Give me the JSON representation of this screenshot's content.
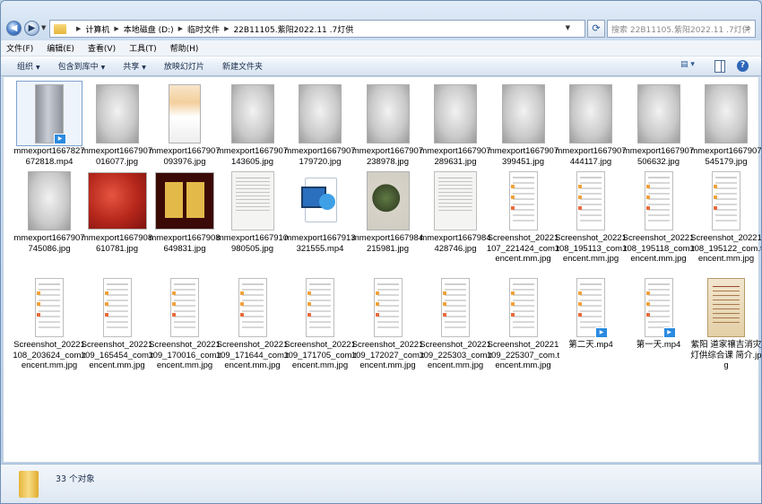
{
  "address": {
    "crumbs": [
      "计算机",
      "本地磁盘 (D:)",
      "临时文件",
      "22B11105.紫阳2022.11 .7灯供"
    ],
    "search_placeholder": "搜索 22B11105.紫阳2022.11 .7灯供"
  },
  "menu": [
    "文件(F)",
    "编辑(E)",
    "查看(V)",
    "工具(T)",
    "帮助(H)"
  ],
  "toolbar": {
    "organize": "组织",
    "include_library": "包含到库中",
    "share": "共享",
    "slideshow": "放映幻灯片",
    "new_folder": "新建文件夹"
  },
  "files": [
    {
      "name": "mmexport1667827672818.mp4",
      "kind": "vid",
      "video": true,
      "selected": true
    },
    {
      "name": "mmexport1667907016077.jpg",
      "kind": "gray"
    },
    {
      "name": "mmexport1667907093976.jpg",
      "kind": "promo"
    },
    {
      "name": "mmexport1667907143605.jpg",
      "kind": "gray"
    },
    {
      "name": "mmexport1667907179720.jpg",
      "kind": "gray"
    },
    {
      "name": "mmexport1667907238978.jpg",
      "kind": "gray"
    },
    {
      "name": "mmexport1667907289631.jpg",
      "kind": "gray"
    },
    {
      "name": "mmexport1667907399451.jpg",
      "kind": "gray"
    },
    {
      "name": "mmexport1667907444117.jpg",
      "kind": "gray"
    },
    {
      "name": "mmexport1667907506632.jpg",
      "kind": "gray"
    },
    {
      "name": "mmexport1667907545179.jpg",
      "kind": "gray"
    },
    {
      "name": "mmexport1667907745086.jpg",
      "kind": "gray"
    },
    {
      "name": "mmexport1667908610781.jpg",
      "kind": "red"
    },
    {
      "name": "mmexport1667908649831.jpg",
      "kind": "gold"
    },
    {
      "name": "mmexport1667910980505.jpg",
      "kind": "doc"
    },
    {
      "name": "mmexport1667913321555.mp4",
      "kind": "media"
    },
    {
      "name": "mmexport1667984215981.jpg",
      "kind": "green"
    },
    {
      "name": "mmexport1667984428746.jpg",
      "kind": "doc"
    },
    {
      "name": "Screenshot_20221107_221424_com.tencent.mm.jpg",
      "kind": "phone"
    },
    {
      "name": "Screenshot_20221108_195113_com.tencent.mm.jpg",
      "kind": "phone"
    },
    {
      "name": "Screenshot_20221108_195118_com.tencent.mm.jpg",
      "kind": "phone"
    },
    {
      "name": "Screenshot_20221108_195122_com.tencent.mm.jpg",
      "kind": "phone"
    },
    {
      "name": "Screenshot_20221108_203624_com.tencent.mm.jpg",
      "kind": "phone"
    },
    {
      "name": "Screenshot_20221109_165454_com.tencent.mm.jpg",
      "kind": "phone"
    },
    {
      "name": "Screenshot_20221109_170016_com.tencent.mm.jpg",
      "kind": "phone"
    },
    {
      "name": "Screenshot_20221109_171644_com.tencent.mm.jpg",
      "kind": "phone"
    },
    {
      "name": "Screenshot_20221109_171705_com.tencent.mm.jpg",
      "kind": "phone"
    },
    {
      "name": "Screenshot_20221109_172027_com.tencent.mm.jpg",
      "kind": "phone"
    },
    {
      "name": "Screenshot_20221109_225303_com.tencent.mm.jpg",
      "kind": "phone"
    },
    {
      "name": "Screenshot_20221109_225307_com.tencent.mm.jpg",
      "kind": "phone"
    },
    {
      "name": "第二天.mp4",
      "kind": "phone",
      "video": true
    },
    {
      "name": "第一天.mp4",
      "kind": "phone",
      "video": true
    },
    {
      "name": "紫阳 道家禳吉消灾灯供综合课 简介.jpg",
      "kind": "scroll"
    }
  ],
  "status": {
    "count": "33 个对象"
  }
}
